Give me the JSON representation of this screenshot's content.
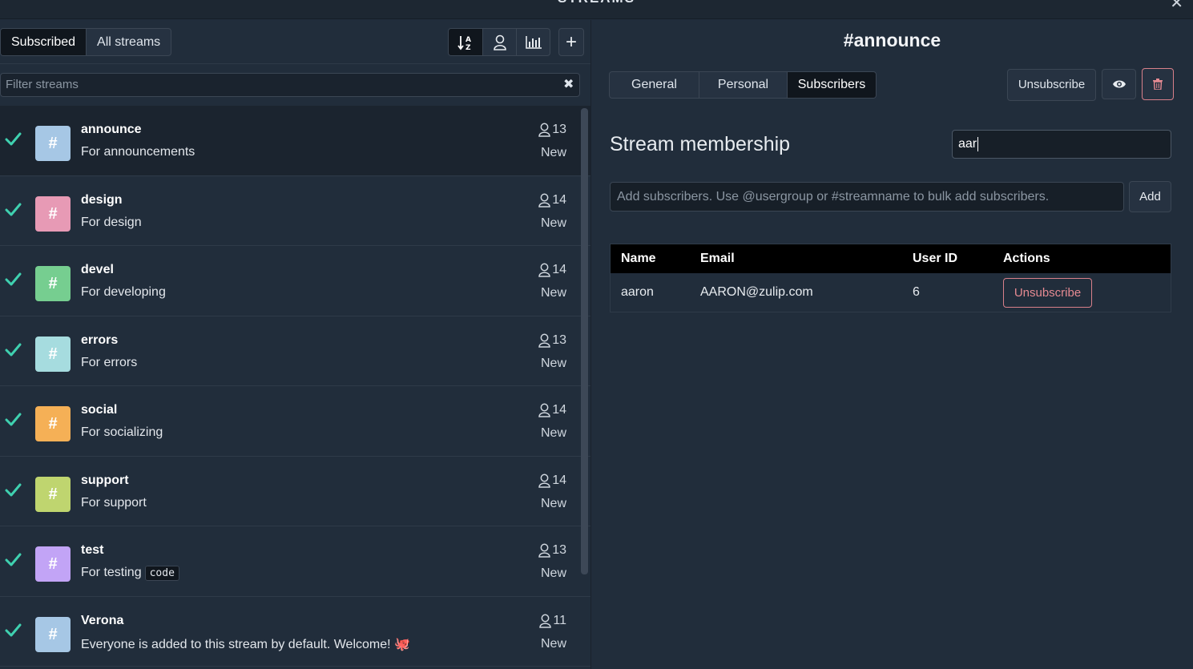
{
  "window": {
    "title": "STREAMS",
    "close_glyph": "✕"
  },
  "left": {
    "tabs": [
      {
        "label": "Subscribed",
        "active": true
      },
      {
        "label": "All streams",
        "active": false
      }
    ],
    "toolbar_icons": [
      "sort-alpha-icon",
      "user-icon",
      "bar-chart-icon"
    ],
    "add_label": "+",
    "filter_placeholder": "Filter streams",
    "filter_clear": "✖",
    "streams": [
      {
        "name": "announce",
        "description": "For announcements",
        "subscribers": "13",
        "new_label": "New",
        "color": "#a6c7e5",
        "selected": true
      },
      {
        "name": "design",
        "description": "For design",
        "subscribers": "14",
        "new_label": "New",
        "color": "#e79ab5"
      },
      {
        "name": "devel",
        "description": "For developing",
        "subscribers": "14",
        "new_label": "New",
        "color": "#76ce90"
      },
      {
        "name": "errors",
        "description": "For errors",
        "subscribers": "13",
        "new_label": "New",
        "color": "#a6dcdf"
      },
      {
        "name": "social",
        "description": "For socializing",
        "subscribers": "14",
        "new_label": "New",
        "color": "#f5b056"
      },
      {
        "name": "support",
        "description": "For support",
        "subscribers": "14",
        "new_label": "New",
        "color": "#bfd56f"
      },
      {
        "name": "test",
        "description": "For testing",
        "code": "code",
        "subscribers": "13",
        "new_label": "New",
        "color": "#c2a4f6"
      },
      {
        "name": "Verona",
        "description": "Everyone is added to this stream by default. Welcome!",
        "subscribers": "11",
        "new_label": "New",
        "color": "#a6c7e5",
        "emoji": "🐙"
      }
    ],
    "hash": "#"
  },
  "right": {
    "stream_title": "#announce",
    "tabs": [
      {
        "label": "General",
        "active": false
      },
      {
        "label": "Personal",
        "active": false
      },
      {
        "label": "Subscribers",
        "active": true
      }
    ],
    "unsubscribe_label": "Unsubscribe",
    "membership_title": "Stream membership",
    "search_value": "aar",
    "add_placeholder": "Add subscribers. Use @usergroup or #streamname to bulk add subscribers.",
    "add_label": "Add",
    "table": {
      "headers": [
        "Name",
        "Email",
        "User ID",
        "Actions"
      ],
      "rows": [
        {
          "name": "aaron",
          "email": "AARON@zulip.com",
          "user_id": "6",
          "action": "Unsubscribe"
        }
      ]
    }
  },
  "colors": {
    "check": "#3fd1b0",
    "danger": "#d8808a"
  }
}
